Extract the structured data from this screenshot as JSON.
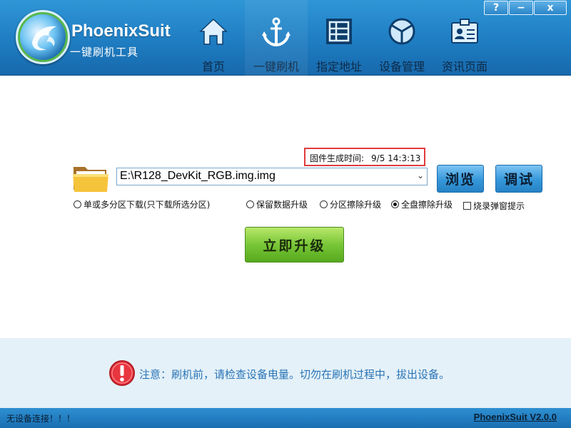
{
  "app": {
    "brand_name": "PhoenixSuit",
    "brand_subtitle": "一键刷机工具"
  },
  "window_controls": {
    "help": "?",
    "minimize": "−",
    "close": "x"
  },
  "nav": {
    "items": [
      {
        "label": "首页",
        "icon": "home-icon"
      },
      {
        "label": "一键刷机",
        "icon": "anchor-icon",
        "active": true
      },
      {
        "label": "指定地址",
        "icon": "grid-icon"
      },
      {
        "label": "设备管理",
        "icon": "cube-icon"
      },
      {
        "label": "资讯页面",
        "icon": "id-card-icon"
      }
    ]
  },
  "firmware": {
    "time_label": "固件生成时间:",
    "time_value": "9/5 14:3:13",
    "path": "E:\\R128_DevKit_RGB.img.img",
    "browse_label": "浏览",
    "debug_label": "调试"
  },
  "options": {
    "single_multi": "单或多分区下载(只下载所选分区)",
    "keep_data": "保留数据升级",
    "partition_erase": "分区擦除升级",
    "full_erase": "全盘擦除升级",
    "burn_popup": "烧录弹窗提示",
    "selected": "full_erase"
  },
  "upgrade_label": "立即升级",
  "notice": "注意：刷机前，请检查设备电量。切勿在刷机过程中，拔出设备。",
  "status": {
    "left": "无设备连接！！！",
    "version": "PhoenixSuit V2.0.0"
  },
  "colors": {
    "header_blue": "#1f7dc2",
    "notice_bg": "#e4f1f8",
    "notice_text": "#2a74b6",
    "upgrade_green": "#79c638",
    "highlight_red": "#e23b3b"
  }
}
